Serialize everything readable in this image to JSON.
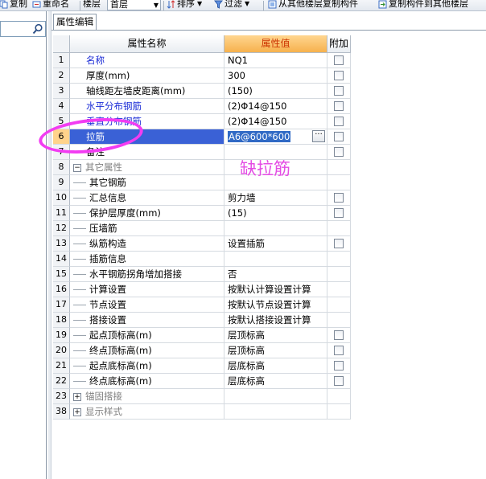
{
  "toolbar": {
    "copy_label": "复制",
    "rename_label": "重命名",
    "floor_label": "楼层",
    "floor_value": "首层",
    "sort_label": "排序",
    "filter_label": "过滤",
    "copy_from_floor_label": "从其他楼层复制构件",
    "copy_to_floor_label": "复制构件到其他楼层"
  },
  "tab": {
    "label": "属性编辑"
  },
  "grid": {
    "headers": {
      "name": "属性名称",
      "value": "属性值",
      "extra": "附加"
    },
    "rows": [
      {
        "num": "1",
        "name": "名称",
        "value": "NQ1"
      },
      {
        "num": "2",
        "name": "厚度(mm)",
        "value": "300"
      },
      {
        "num": "3",
        "name": "轴线距左墙皮距离(mm)",
        "value": "(150)"
      },
      {
        "num": "4",
        "name": "水平分布钢筋",
        "value": "(2)Φ14@150"
      },
      {
        "num": "5",
        "name": "垂直分布钢筋",
        "value": "(2)Φ14@150"
      },
      {
        "num": "6",
        "name": "拉筋",
        "value": "A6@600*600"
      },
      {
        "num": "7",
        "name": "备注",
        "value": ""
      },
      {
        "num": "8",
        "name": "其它属性",
        "value": ""
      },
      {
        "num": "9",
        "name": "其它钢筋",
        "value": ""
      },
      {
        "num": "10",
        "name": "汇总信息",
        "value": "剪力墙"
      },
      {
        "num": "11",
        "name": "保护层厚度(mm)",
        "value": "(15)"
      },
      {
        "num": "12",
        "name": "压墙筋",
        "value": ""
      },
      {
        "num": "13",
        "name": "纵筋构造",
        "value": "设置插筋"
      },
      {
        "num": "14",
        "name": "插筋信息",
        "value": ""
      },
      {
        "num": "15",
        "name": "水平钢筋拐角增加搭接",
        "value": "否"
      },
      {
        "num": "16",
        "name": "计算设置",
        "value": "按默认计算设置计算"
      },
      {
        "num": "17",
        "name": "节点设置",
        "value": "按默认节点设置计算"
      },
      {
        "num": "18",
        "name": "搭接设置",
        "value": "按默认搭接设置计算"
      },
      {
        "num": "19",
        "name": "起点顶标高(m)",
        "value": "层顶标高"
      },
      {
        "num": "20",
        "name": "终点顶标高(m)",
        "value": "层顶标高"
      },
      {
        "num": "21",
        "name": "起点底标高(m)",
        "value": "层底标高"
      },
      {
        "num": "22",
        "name": "终点底标高(m)",
        "value": "层底标高"
      },
      {
        "num": "23",
        "name": "锚固搭接",
        "value": ""
      },
      {
        "num": "38",
        "name": "显示样式",
        "value": ""
      }
    ]
  },
  "annotation": {
    "text": "缺拉筋",
    "color": "#e44ce4"
  },
  "colors": {
    "header_value_bg": "#f6b14d",
    "selected_row": "#3a61d6",
    "blue_text": "#1a2bd6"
  }
}
